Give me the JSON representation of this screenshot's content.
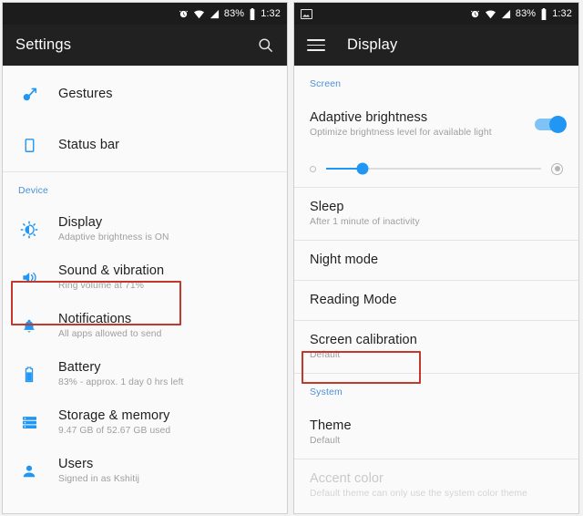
{
  "status_bar": {
    "left_icons": [
      "image-icon"
    ],
    "alarm_icon": "alarm-icon",
    "wifi_icon": "wifi-icon",
    "signal_icon": "signal-icon",
    "battery_percent": "83%",
    "battery_icon": "battery-icon",
    "time": "1:32"
  },
  "left_panel": {
    "appbar": {
      "title": "Settings",
      "search_icon": "search-icon"
    },
    "groups": [
      {
        "label": null,
        "items": [
          {
            "icon": "gestures-icon",
            "title": "Gestures",
            "subtitle": null
          },
          {
            "icon": "status-bar-icon",
            "title": "Status bar",
            "subtitle": null
          }
        ]
      },
      {
        "label": "Device",
        "items": [
          {
            "icon": "brightness-icon",
            "title": "Display",
            "subtitle": "Adaptive brightness is ON",
            "highlighted": true
          },
          {
            "icon": "volume-icon",
            "title": "Sound & vibration",
            "subtitle": "Ring volume at 71%"
          },
          {
            "icon": "bell-icon",
            "title": "Notifications",
            "subtitle": "All apps allowed to send"
          },
          {
            "icon": "battery-icon",
            "title": "Battery",
            "subtitle": "83% - approx. 1 day 0 hrs left"
          },
          {
            "icon": "storage-icon",
            "title": "Storage & memory",
            "subtitle": "9.47 GB of 52.67 GB used"
          },
          {
            "icon": "person-icon",
            "title": "Users",
            "subtitle": "Signed in as Kshitij"
          }
        ]
      }
    ]
  },
  "right_panel": {
    "appbar": {
      "menu_icon": "hamburger-icon",
      "title": "Display"
    },
    "sections": [
      {
        "label": "Screen",
        "items": [
          {
            "title": "Adaptive brightness",
            "subtitle": "Optimize brightness level for available light",
            "control": "toggle-switch",
            "toggle_state": "on"
          },
          {
            "control": "brightness-slider",
            "slider_value_percent": 17,
            "low_icon": "brightness-low-icon",
            "high_icon": "brightness-high-icon"
          },
          {
            "title": "Sleep",
            "subtitle": "After 1 minute of inactivity"
          },
          {
            "title": "Night mode",
            "subtitle": null
          },
          {
            "title": "Reading Mode",
            "subtitle": null,
            "highlighted": true
          },
          {
            "title": "Screen calibration",
            "subtitle": "Default"
          }
        ]
      },
      {
        "label": "System",
        "items": [
          {
            "title": "Theme",
            "subtitle": "Default"
          },
          {
            "title": "Accent color",
            "subtitle": "Default theme can only use the system color theme",
            "disabled": true
          }
        ]
      }
    ]
  },
  "annotations": {
    "highlight_color": "#c0392b",
    "accent_color": "#2196f3",
    "section_label_color": "#4a90d9",
    "appbar_color": "#212121"
  }
}
